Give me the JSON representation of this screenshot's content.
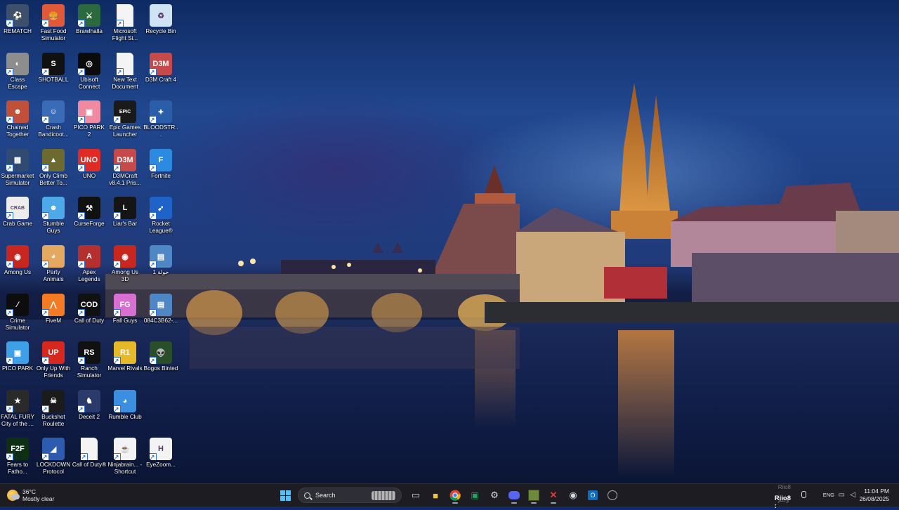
{
  "desktop": {
    "icons": [
      {
        "label": "REMATCH",
        "icon": "rematch-icon",
        "bg": "#3d4f6b"
      },
      {
        "label": "Fast Food Simulator",
        "icon": "fast-food-icon",
        "bg": "#e05a3a"
      },
      {
        "label": "Brawlhalla",
        "icon": "brawlhalla-icon",
        "bg": "#2b6a3e"
      },
      {
        "label": "Microsoft Flight Si...",
        "icon": "file-icon",
        "bg": "#f4f4f4"
      },
      {
        "label": "Recycle Bin",
        "icon": "recycle-bin-icon",
        "bg": "#cfe3f4"
      },
      {
        "label": "Class Escape",
        "icon": "class-escape-icon",
        "bg": "#8d8d8d"
      },
      {
        "label": "SHOTBALL",
        "icon": "shotball-icon",
        "bg": "#111"
      },
      {
        "label": "Ubisoft Connect",
        "icon": "ubisoft-icon",
        "bg": "#0b0b0b"
      },
      {
        "label": "New Text Document",
        "icon": "file-icon",
        "bg": "#f4f4f4"
      },
      {
        "label": "D3M Craft 4",
        "icon": "d3m-craft-icon",
        "bg": "#c64a4a"
      },
      {
        "label": "Chained Together",
        "icon": "chained-together-icon",
        "bg": "#c0503a"
      },
      {
        "label": "Crash Bandicoot...",
        "icon": "crash-icon",
        "bg": "#3a6bb7"
      },
      {
        "label": "PICO PARK 2",
        "icon": "pico-park-2-icon",
        "bg": "#f18aa1"
      },
      {
        "label": "Epic Games Launcher",
        "icon": "epic-games-icon",
        "bg": "#1a1a1a"
      },
      {
        "label": "BLOODSTR...",
        "icon": "bloodstrike-icon",
        "bg": "#2a5ea8"
      },
      {
        "label": "Supermarket Simulator",
        "icon": "supermarket-icon",
        "bg": "#304a72"
      },
      {
        "label": "Only Climb Better To...",
        "icon": "only-climb-icon",
        "bg": "#6d6a2f"
      },
      {
        "label": "UNO",
        "icon": "uno-icon",
        "bg": "#e02a24"
      },
      {
        "label": "D3MCraft v8.4.1 Pris...",
        "icon": "d3m-craft-icon",
        "bg": "#c64a4a"
      },
      {
        "label": "Fortnite",
        "icon": "fortnite-icon",
        "bg": "#2c8be0"
      },
      {
        "label": "Crab Game",
        "icon": "crab-game-icon",
        "bg": "#ededed"
      },
      {
        "label": "Stumble Guys",
        "icon": "stumble-guys-icon",
        "bg": "#4ea9e8"
      },
      {
        "label": "CurseForge",
        "icon": "curseforge-icon",
        "bg": "#111"
      },
      {
        "label": "Liar's Bar",
        "icon": "liars-bar-icon",
        "bg": "#151515"
      },
      {
        "label": "Rocket League®",
        "icon": "rocket-league-icon",
        "bg": "#1f62c8"
      },
      {
        "label": "Among Us",
        "icon": "among-us-icon",
        "bg": "#c7271f"
      },
      {
        "label": "Party Animals",
        "icon": "party-animals-icon",
        "bg": "#e5a860"
      },
      {
        "label": "Apex Legends",
        "icon": "apex-icon",
        "bg": "#b3302e"
      },
      {
        "label": "Among Us 3D",
        "icon": "among-us-icon",
        "bg": "#c7271f"
      },
      {
        "label": "حولة 1",
        "icon": "image-file-icon",
        "bg": "#4f86c6"
      },
      {
        "label": "Crime Simulator",
        "icon": "crime-simulator-icon",
        "bg": "#0d0d0d"
      },
      {
        "label": "FiveM",
        "icon": "fivem-icon",
        "bg": "#f47a24"
      },
      {
        "label": "Call of Duty",
        "icon": "call-of-duty-icon",
        "bg": "#111"
      },
      {
        "label": "Fall Guys",
        "icon": "fall-guys-icon",
        "bg": "#d96fd2"
      },
      {
        "label": "084C3B62-...",
        "icon": "image-file-icon",
        "bg": "#4f86c6"
      },
      {
        "label": "PICO PARK",
        "icon": "pico-park-icon",
        "bg": "#3ea0e6"
      },
      {
        "label": "Only Up With Friends",
        "icon": "only-up-icon",
        "bg": "#d7271f"
      },
      {
        "label": "Ranch Simulator",
        "icon": "ranch-simulator-icon",
        "bg": "#111"
      },
      {
        "label": "Marvel Rivals",
        "icon": "marvel-rivals-icon",
        "bg": "#e5b928"
      },
      {
        "label": "Bogos Binted",
        "icon": "alien-icon",
        "bg": "#2a4e2a"
      },
      {
        "label": "FATAL FURY City of the ...",
        "icon": "fatal-fury-icon",
        "bg": "#2a2a2a"
      },
      {
        "label": "Buckshot Roulette",
        "icon": "buckshot-icon",
        "bg": "#1b1b1b"
      },
      {
        "label": "Deceit 2",
        "icon": "deceit-icon",
        "bg": "#2a3a6a"
      },
      {
        "label": "Rumble Club",
        "icon": "rumble-club-icon",
        "bg": "#3c8ee0"
      },
      null,
      {
        "label": "Fears to Fatho...",
        "icon": "f2f-icon",
        "bg": "#0f2f15"
      },
      {
        "label": "LOCKDOWN Protocol",
        "icon": "lockdown-icon",
        "bg": "#2d5bb0"
      },
      {
        "label": "Call of Duty®",
        "icon": "file-icon",
        "bg": "#f4f4f4"
      },
      {
        "label": "Ninjabrain... - Shortcut",
        "icon": "java-icon",
        "bg": "#f3f3f3"
      },
      {
        "label": "EyeZoom...",
        "icon": "eyezoom-icon",
        "bg": "#f3f3f3"
      }
    ],
    "glyphs": {
      "rematch-icon": "⚽",
      "fast-food-icon": "🍔",
      "brawlhalla-icon": "⚔",
      "file-icon": "",
      "recycle-bin-icon": "♻",
      "class-escape-icon": "◐",
      "shotball-icon": "S",
      "ubisoft-icon": "◎",
      "d3m-craft-icon": "D3M",
      "chained-together-icon": "☻",
      "crash-icon": "☺",
      "pico-park-2-icon": "▣",
      "epic-games-icon": "EPIC",
      "bloodstrike-icon": "✦",
      "supermarket-icon": "▦",
      "only-climb-icon": "▲",
      "uno-icon": "UNO",
      "fortnite-icon": "F",
      "crab-game-icon": "CRAB",
      "stumble-guys-icon": "☻",
      "curseforge-icon": "⚒",
      "liars-bar-icon": "L",
      "rocket-league-icon": "➹",
      "among-us-icon": "◉",
      "party-animals-icon": "◕",
      "apex-icon": "A",
      "image-file-icon": "▤",
      "crime-simulator-icon": "∕",
      "fivem-icon": "⋀",
      "call-of-duty-icon": "COD",
      "fall-guys-icon": "FG",
      "pico-park-icon": "▣",
      "only-up-icon": "UP",
      "ranch-simulator-icon": "RS",
      "marvel-rivals-icon": "R1",
      "alien-icon": "👽",
      "fatal-fury-icon": "★",
      "buckshot-icon": "☠",
      "deceit-icon": "♞",
      "rumble-club-icon": "◕",
      "f2f-icon": "F2F",
      "lockdown-icon": "◢",
      "java-icon": "☕",
      "eyezoom-icon": "H"
    }
  },
  "taskbar": {
    "weather": {
      "temp": "36°C",
      "condition": "Mostly clear"
    },
    "search_placeholder": "Search",
    "apps": [
      {
        "name": "start-button",
        "glyph": ""
      },
      {
        "name": "task-view",
        "glyph": "▭"
      },
      {
        "name": "file-explorer",
        "glyph": "📁"
      },
      {
        "name": "chrome",
        "glyph": "◉"
      },
      {
        "name": "excel-like",
        "glyph": "▣"
      },
      {
        "name": "steam-overlay",
        "glyph": "⚙"
      },
      {
        "name": "discord",
        "glyph": "☺"
      },
      {
        "name": "minecraft",
        "glyph": "▩"
      },
      {
        "name": "x-app",
        "glyph": "✕"
      },
      {
        "name": "steam",
        "glyph": "♨"
      },
      {
        "name": "outlook",
        "glyph": "✉"
      },
      {
        "name": "app-circle",
        "glyph": "◍"
      }
    ],
    "tray": {
      "user_label": "Riio8 :",
      "user_label_faint": "Riio8 : وكلم",
      "language": "ENG",
      "time": "11:04 PM",
      "date": "26/08/2025"
    }
  }
}
